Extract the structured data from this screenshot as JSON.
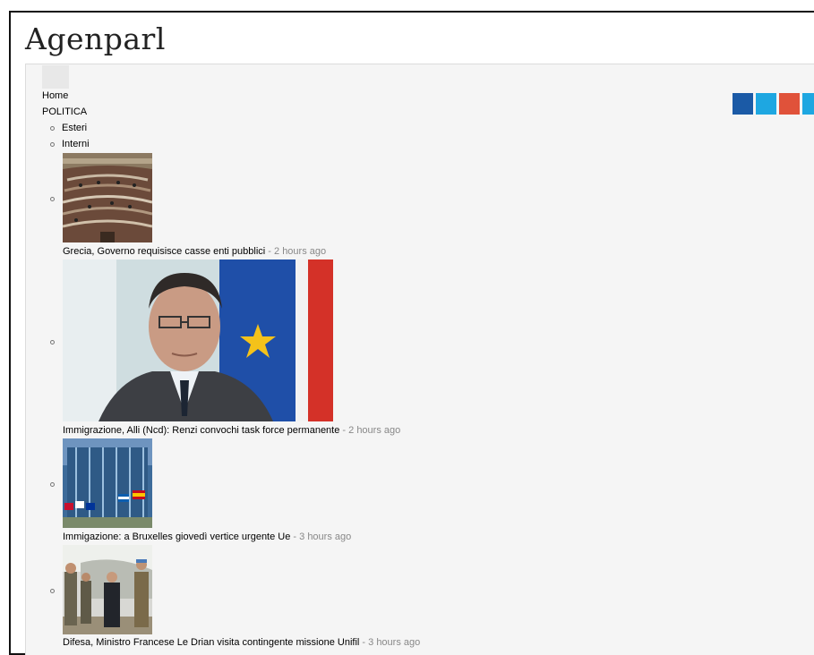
{
  "site": {
    "title": "Agenparl"
  },
  "nav": {
    "home": "Home",
    "politica": "POLITICA",
    "sub": [
      "Esteri",
      "Interni"
    ]
  },
  "social": [
    {
      "name": "facebook-icon",
      "color": "#1b5aa6"
    },
    {
      "name": "twitter-icon",
      "color": "#1ea7e1"
    },
    {
      "name": "googleplus-icon",
      "color": "#e0523a"
    },
    {
      "name": "linkedin-icon",
      "color": "#1ea7e1"
    }
  ],
  "news": [
    {
      "title": "Grecia, Governo requisisce casse enti pubblici",
      "time": "2 hours ago"
    },
    {
      "title": "Immigrazione, Alli (Ncd): Renzi convochi task force permanente",
      "time": "2 hours ago"
    },
    {
      "title": "Immigazione: a Bruxelles giovedì vertice urgente Ue",
      "time": "3 hours ago"
    },
    {
      "title": "Difesa, Ministro Francese Le Drian visita contingente missione Unifil",
      "time": "3 hours ago"
    }
  ],
  "separator": " - "
}
